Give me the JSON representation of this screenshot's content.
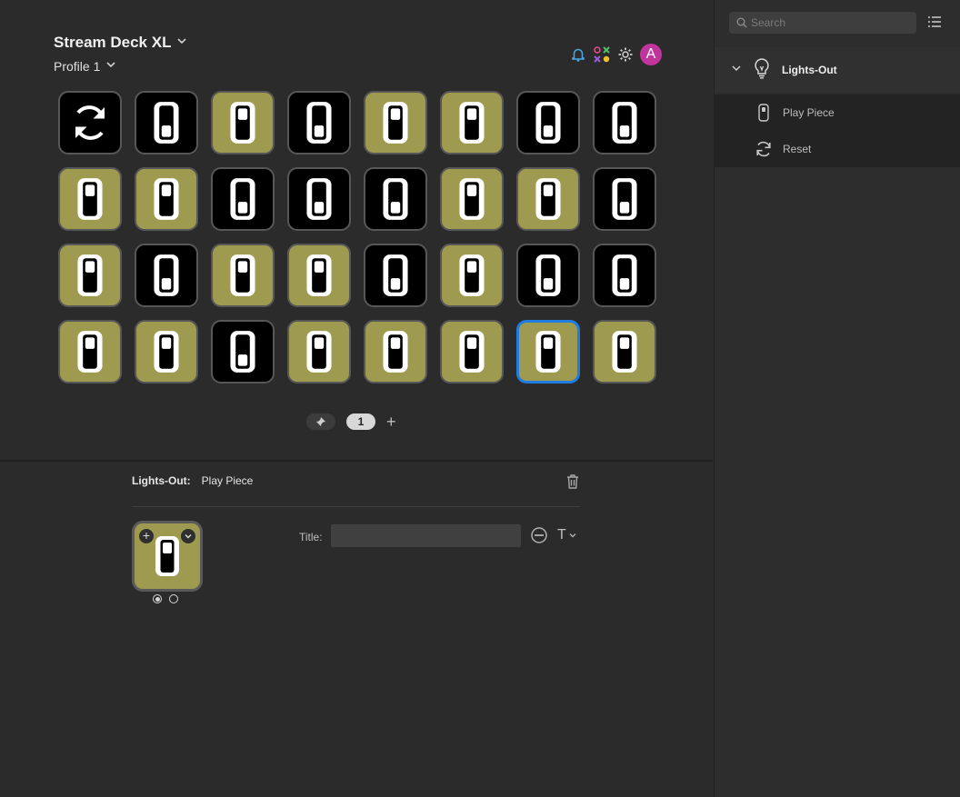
{
  "header": {
    "device_name": "Stream Deck XL",
    "profile_name": "Profile 1",
    "avatar_letter": "A"
  },
  "grid": {
    "columns": 8,
    "rows": 4,
    "keys": [
      [
        "reset",
        "off",
        "on",
        "off",
        "on",
        "on",
        "off",
        "off"
      ],
      [
        "on",
        "on",
        "off",
        "off",
        "off",
        "on",
        "on",
        "off"
      ],
      [
        "on",
        "off",
        "on",
        "on",
        "off",
        "on",
        "off",
        "off"
      ],
      [
        "on",
        "on",
        "off",
        "on",
        "on",
        "on",
        "on",
        "on"
      ]
    ],
    "selected": "row 4, column 7"
  },
  "pager": {
    "current_page": "1",
    "add_symbol": "+"
  },
  "inspector": {
    "plugin_label": "Lights-Out:",
    "action_label": "Play Piece",
    "title_label": "Title:",
    "title_value": "",
    "font_glyph": "T",
    "add_symbol": "+"
  },
  "sidebar": {
    "search_placeholder": "Search",
    "category": "Lights-Out",
    "actions": [
      {
        "label": "Play Piece",
        "icon": "switch-icon"
      },
      {
        "label": "Reset",
        "icon": "reset-icon"
      }
    ]
  },
  "colors": {
    "key_on": "#9e9a4f",
    "key_off": "#000000",
    "selected_border": "#1f7ce0",
    "avatar": "#c0359b",
    "background": "#2b2b2b"
  }
}
